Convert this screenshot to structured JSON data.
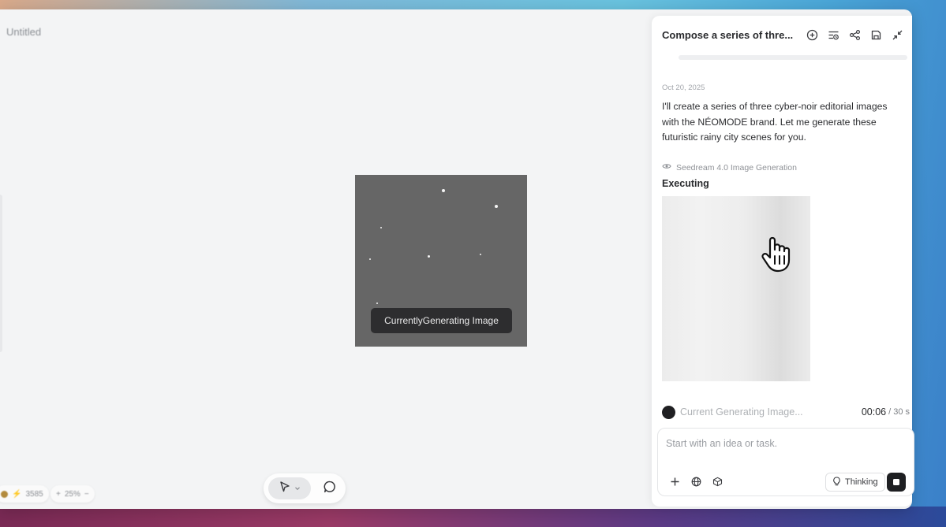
{
  "document": {
    "title": "Untitled"
  },
  "canvas": {
    "generating_label": "CurrentlyGenerating Image"
  },
  "status_bar": {
    "credits": "3585",
    "zoom": "25%",
    "zoom_in": "+",
    "zoom_out": "−"
  },
  "toolbar": {
    "select_tool_icon": "pointer-icon",
    "select_dropdown_icon": "chevron-down-icon",
    "comment_tool_icon": "comment-icon"
  },
  "chat": {
    "title": "Compose a series of thre...",
    "header_icons": [
      "new-chat-icon",
      "history-icon",
      "share-icon",
      "save-icon",
      "collapse-icon"
    ],
    "message": {
      "date": "Oct 20, 2025",
      "text": "I'll create a series of three cyber-noir editorial images with the NÉOMODE brand. Let me generate these futuristic rainy city scenes for you."
    },
    "tool_call": {
      "name": "Seedream 4.0 Image Generation",
      "status": "Executing"
    },
    "progress": {
      "text": "Current  Generating Image...",
      "elapsed": "00:06",
      "total": "/ 30 s"
    },
    "composer": {
      "placeholder": "Start with an idea or task.",
      "thinking_label": "Thinking"
    }
  }
}
